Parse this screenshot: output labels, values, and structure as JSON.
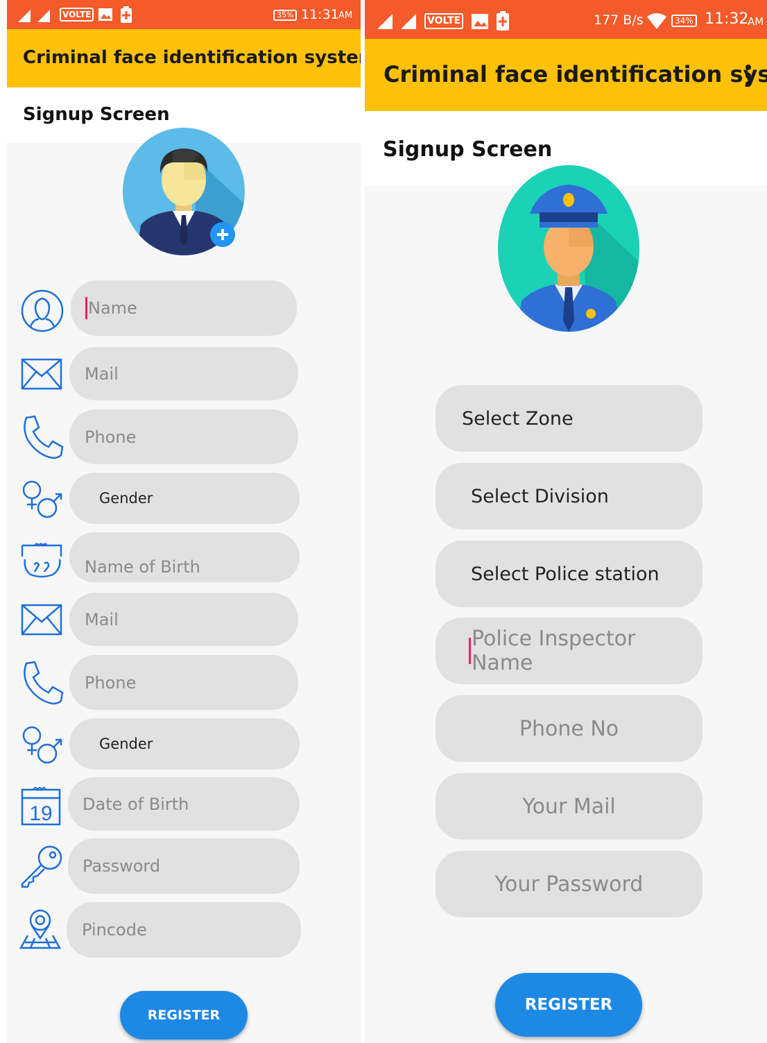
{
  "left": {
    "status": {
      "volte": "VOLTE",
      "battery": "35%",
      "time": "11:31",
      "ampm": "AM"
    },
    "app_title": "Criminal face identification system",
    "screen_title": "Signup Screen",
    "fields": [
      {
        "icon": "person-outline-icon",
        "text": "Name",
        "kind": "placeholder",
        "focused": true
      },
      {
        "icon": "mail-icon",
        "text": "Mail",
        "kind": "placeholder"
      },
      {
        "icon": "phone-icon",
        "text": "Phone",
        "kind": "placeholder"
      },
      {
        "icon": "gender-icon",
        "text": "Gender",
        "kind": "spinner"
      },
      {
        "icon": "calendar-icon",
        "text": "Name of Birth",
        "kind": "placeholder",
        "clipped": true
      },
      {
        "icon": "mail-icon",
        "text": "Mail",
        "kind": "placeholder"
      },
      {
        "icon": "phone-icon",
        "text": "Phone",
        "kind": "placeholder"
      },
      {
        "icon": "gender-icon",
        "text": "Gender",
        "kind": "spinner"
      },
      {
        "icon": "calendar-icon",
        "text": "Date of Birth",
        "kind": "placeholder",
        "calendar_day": "19"
      },
      {
        "icon": "key-icon",
        "text": "Password",
        "kind": "placeholder"
      },
      {
        "icon": "location-pin-icon",
        "text": "Pincode",
        "kind": "placeholder"
      }
    ],
    "register_label": "REGISTER"
  },
  "right": {
    "status": {
      "volte": "VOLTE",
      "speed": "177 B/s",
      "battery": "34%",
      "time": "11:32",
      "ampm": "AM"
    },
    "app_title": "Criminal face identification syst...",
    "screen_title": "Signup Screen",
    "fields": [
      {
        "text": "Select Zone",
        "kind": "spinner"
      },
      {
        "text": "Select Division",
        "kind": "spinner"
      },
      {
        "text": "Select Police station",
        "kind": "spinner"
      },
      {
        "text": "Police Inspector Name",
        "kind": "placeholder",
        "focused": true
      },
      {
        "text": "Phone No",
        "kind": "placeholder"
      },
      {
        "text": "Your Mail",
        "kind": "placeholder"
      },
      {
        "text": "Your Password",
        "kind": "placeholder"
      }
    ],
    "register_label": "REGISTER"
  },
  "colors": {
    "status_bar": "#f45a2a",
    "app_bar": "#ffc107",
    "field_bg": "#e1e1e1",
    "button": "#1e88e5",
    "icon_blue": "#1e6fd9",
    "cursor": "#e91e63"
  }
}
